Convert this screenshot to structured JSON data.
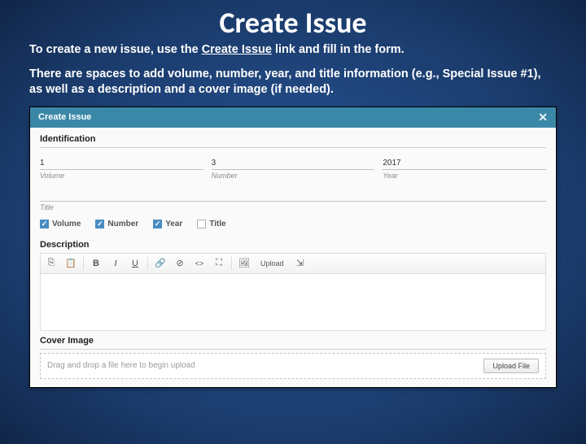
{
  "slide": {
    "title": "Create Issue",
    "para1a": "To create a new issue, use the ",
    "para1b": "Create Issue",
    "para1c": " link and fill in the form.",
    "para2": "There are spaces to add volume, number, year, and title information (e.g., Special Issue #1), as well as a description and a cover image (if needed)."
  },
  "panel": {
    "header": "Create Issue",
    "identification": {
      "heading": "Identification",
      "volume": {
        "value": "1",
        "label": "Volume"
      },
      "number": {
        "value": "3",
        "label": "Number"
      },
      "year": {
        "value": "2017",
        "label": "Year"
      },
      "title_label": "Title"
    },
    "checks": {
      "volume": "Volume",
      "number": "Number",
      "year": "Year",
      "title": "Title"
    },
    "description": {
      "heading": "Description",
      "upload": "Upload"
    },
    "cover": {
      "heading": "Cover Image",
      "drop_text": "Drag and drop a file here to begin upload",
      "upload_btn": "Upload File"
    }
  }
}
